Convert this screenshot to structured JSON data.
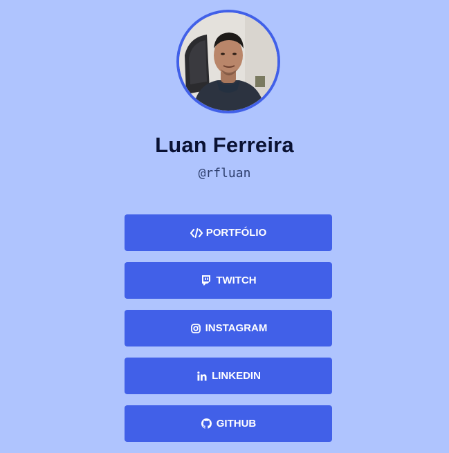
{
  "profile": {
    "name": "Luan Ferreira",
    "handle": "@rfluan"
  },
  "links": [
    {
      "label": "PORTFÓLIO",
      "icon": "code-icon"
    },
    {
      "label": "TWITCH",
      "icon": "twitch-icon"
    },
    {
      "label": "INSTAGRAM",
      "icon": "instagram-icon"
    },
    {
      "label": "LINKEDIN",
      "icon": "linkedin-icon"
    },
    {
      "label": "GITHUB",
      "icon": "github-icon"
    }
  ],
  "colors": {
    "background": "#afc4fe",
    "accent": "#4160e8",
    "name_text": "#0a1233"
  }
}
